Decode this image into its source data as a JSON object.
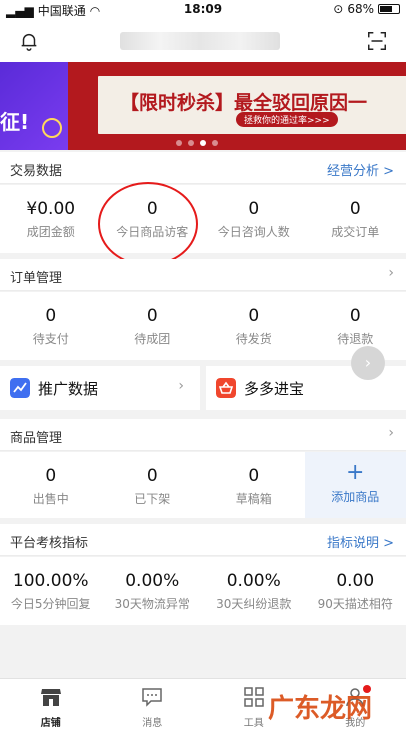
{
  "status": {
    "carrier": "中国联通",
    "time": "18:09",
    "battery": "68%"
  },
  "banner": {
    "left_text": "征!",
    "title": "【限时秒杀】最全驳回原因一",
    "tag": "拯救你的通过率>>>"
  },
  "trade": {
    "title": "交易数据",
    "link": "经营分析 >",
    "metrics": [
      {
        "value": "¥0.00",
        "label": "成团金额"
      },
      {
        "value": "0",
        "label": "今日商品访客"
      },
      {
        "value": "0",
        "label": "今日咨询人数"
      },
      {
        "value": "0",
        "label": "成交订单"
      }
    ]
  },
  "orders": {
    "title": "订单管理",
    "metrics": [
      {
        "value": "0",
        "label": "待支付"
      },
      {
        "value": "0",
        "label": "待成团"
      },
      {
        "value": "0",
        "label": "待发货"
      },
      {
        "value": "0",
        "label": "待退款"
      }
    ]
  },
  "promo": {
    "left": "推广数据",
    "right": "多多进宝"
  },
  "goods": {
    "title": "商品管理",
    "metrics": [
      {
        "value": "0",
        "label": "出售中"
      },
      {
        "value": "0",
        "label": "已下架"
      },
      {
        "value": "0",
        "label": "草稿箱"
      }
    ],
    "add_plus": "+",
    "add_label": "添加商品"
  },
  "platform": {
    "title": "平台考核指标",
    "link": "指标说明 >",
    "metrics": [
      {
        "value": "100.00%",
        "label": "今日5分钟回复"
      },
      {
        "value": "0.00%",
        "label": "30天物流异常"
      },
      {
        "value": "0.00%",
        "label": "30天纠纷退款"
      },
      {
        "value": "0.00",
        "label": "90天描述相符"
      }
    ]
  },
  "tabs": [
    {
      "label": "店铺"
    },
    {
      "label": "消息"
    },
    {
      "label": "工具"
    },
    {
      "label": "我的"
    }
  ],
  "watermark": "广东龙网",
  "colors": {
    "accent": "#3a78c8",
    "brand_red": "#b3191e",
    "highlight": "#e51b1b"
  }
}
